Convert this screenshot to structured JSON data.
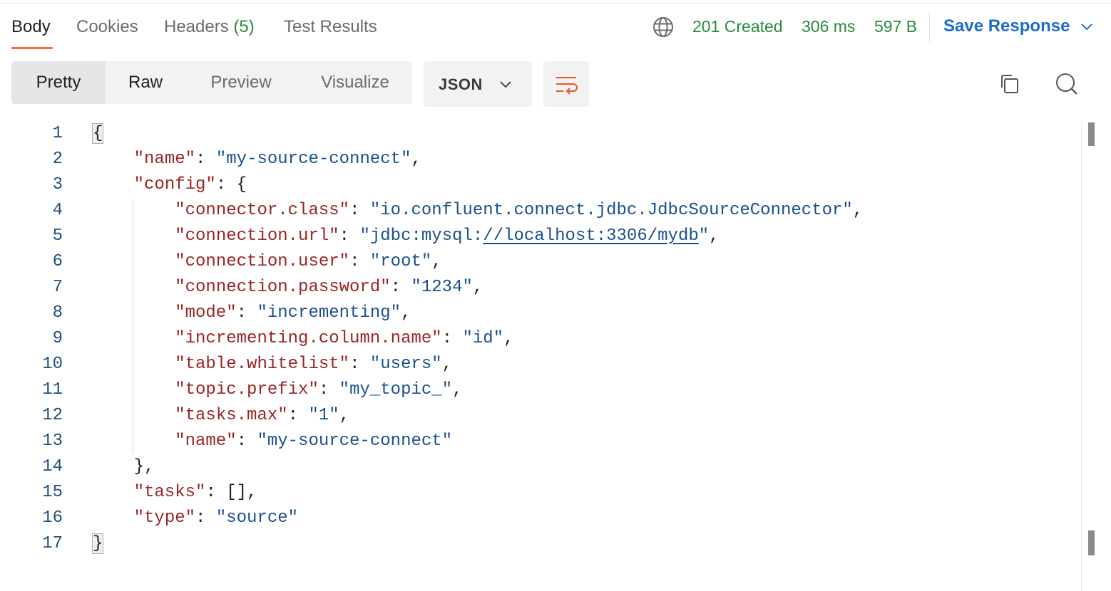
{
  "tabs": [
    {
      "label": "Body"
    },
    {
      "label": "Cookies"
    },
    {
      "label": "Headers",
      "count": "(5)"
    },
    {
      "label": "Test Results"
    }
  ],
  "status": {
    "code": "201 Created",
    "time": "306 ms",
    "size": "597 B",
    "icon": "globe-icon",
    "color": "#2a8a3e"
  },
  "save_response": {
    "label": "Save Response",
    "icon": "chevron-down-icon",
    "color": "#1f6bc9"
  },
  "view_modes": [
    {
      "label": "Pretty",
      "selected": true
    },
    {
      "label": "Raw"
    },
    {
      "label": "Preview"
    },
    {
      "label": "Visualize"
    }
  ],
  "format": {
    "selected": "JSON",
    "icon": "chevron-down-icon"
  },
  "toolbar_icons": [
    "wrap-lines-icon",
    "copy-icon",
    "search-icon"
  ],
  "code": {
    "line_numbers": [
      "1",
      "2",
      "3",
      "4",
      "5",
      "6",
      "7",
      "8",
      "9",
      "10",
      "11",
      "12",
      "13",
      "14",
      "15",
      "16",
      "17"
    ],
    "lines": [
      {
        "parts": [
          {
            "t": "p",
            "v": "{"
          }
        ]
      },
      {
        "parts": [
          {
            "t": "p",
            "v": "    "
          },
          {
            "t": "k",
            "v": "\"name\""
          },
          {
            "t": "p",
            "v": ": "
          },
          {
            "t": "s",
            "v": "\"my-source-connect\""
          },
          {
            "t": "p",
            "v": ","
          }
        ]
      },
      {
        "parts": [
          {
            "t": "p",
            "v": "    "
          },
          {
            "t": "k",
            "v": "\"config\""
          },
          {
            "t": "p",
            "v": ": {"
          }
        ]
      },
      {
        "parts": [
          {
            "t": "p",
            "v": "        "
          },
          {
            "t": "k",
            "v": "\"connector.class\""
          },
          {
            "t": "p",
            "v": ": "
          },
          {
            "t": "s",
            "v": "\"io.confluent.connect.jdbc.JdbcSourceConnector\""
          },
          {
            "t": "p",
            "v": ","
          }
        ]
      },
      {
        "parts": [
          {
            "t": "p",
            "v": "        "
          },
          {
            "t": "k",
            "v": "\"connection.url\""
          },
          {
            "t": "p",
            "v": ": "
          },
          {
            "t": "s",
            "v": "\"jdbc:mysql:"
          },
          {
            "t": "u",
            "v": "//localhost:3306/mydb"
          },
          {
            "t": "s",
            "v": "\""
          },
          {
            "t": "p",
            "v": ","
          }
        ]
      },
      {
        "parts": [
          {
            "t": "p",
            "v": "        "
          },
          {
            "t": "k",
            "v": "\"connection.user\""
          },
          {
            "t": "p",
            "v": ": "
          },
          {
            "t": "s",
            "v": "\"root\""
          },
          {
            "t": "p",
            "v": ","
          }
        ]
      },
      {
        "parts": [
          {
            "t": "p",
            "v": "        "
          },
          {
            "t": "k",
            "v": "\"connection.password\""
          },
          {
            "t": "p",
            "v": ": "
          },
          {
            "t": "s",
            "v": "\"1234\""
          },
          {
            "t": "p",
            "v": ","
          }
        ]
      },
      {
        "parts": [
          {
            "t": "p",
            "v": "        "
          },
          {
            "t": "k",
            "v": "\"mode\""
          },
          {
            "t": "p",
            "v": ": "
          },
          {
            "t": "s",
            "v": "\"incrementing\""
          },
          {
            "t": "p",
            "v": ","
          }
        ]
      },
      {
        "parts": [
          {
            "t": "p",
            "v": "        "
          },
          {
            "t": "k",
            "v": "\"incrementing.column.name\""
          },
          {
            "t": "p",
            "v": ": "
          },
          {
            "t": "s",
            "v": "\"id\""
          },
          {
            "t": "p",
            "v": ","
          }
        ]
      },
      {
        "parts": [
          {
            "t": "p",
            "v": "        "
          },
          {
            "t": "k",
            "v": "\"table.whitelist\""
          },
          {
            "t": "p",
            "v": ": "
          },
          {
            "t": "s",
            "v": "\"users\""
          },
          {
            "t": "p",
            "v": ","
          }
        ]
      },
      {
        "parts": [
          {
            "t": "p",
            "v": "        "
          },
          {
            "t": "k",
            "v": "\"topic.prefix\""
          },
          {
            "t": "p",
            "v": ": "
          },
          {
            "t": "s",
            "v": "\"my_topic_\""
          },
          {
            "t": "p",
            "v": ","
          }
        ]
      },
      {
        "parts": [
          {
            "t": "p",
            "v": "        "
          },
          {
            "t": "k",
            "v": "\"tasks.max\""
          },
          {
            "t": "p",
            "v": ": "
          },
          {
            "t": "s",
            "v": "\"1\""
          },
          {
            "t": "p",
            "v": ","
          }
        ]
      },
      {
        "parts": [
          {
            "t": "p",
            "v": "        "
          },
          {
            "t": "k",
            "v": "\"name\""
          },
          {
            "t": "p",
            "v": ": "
          },
          {
            "t": "s",
            "v": "\"my-source-connect\""
          }
        ]
      },
      {
        "parts": [
          {
            "t": "p",
            "v": "    },"
          }
        ]
      },
      {
        "parts": [
          {
            "t": "p",
            "v": "    "
          },
          {
            "t": "k",
            "v": "\"tasks\""
          },
          {
            "t": "p",
            "v": ": [],"
          }
        ]
      },
      {
        "parts": [
          {
            "t": "p",
            "v": "    "
          },
          {
            "t": "k",
            "v": "\"type\""
          },
          {
            "t": "p",
            "v": ": "
          },
          {
            "t": "s",
            "v": "\"source\""
          }
        ]
      },
      {
        "parts": [
          {
            "t": "p",
            "v": "}"
          }
        ]
      }
    ]
  }
}
